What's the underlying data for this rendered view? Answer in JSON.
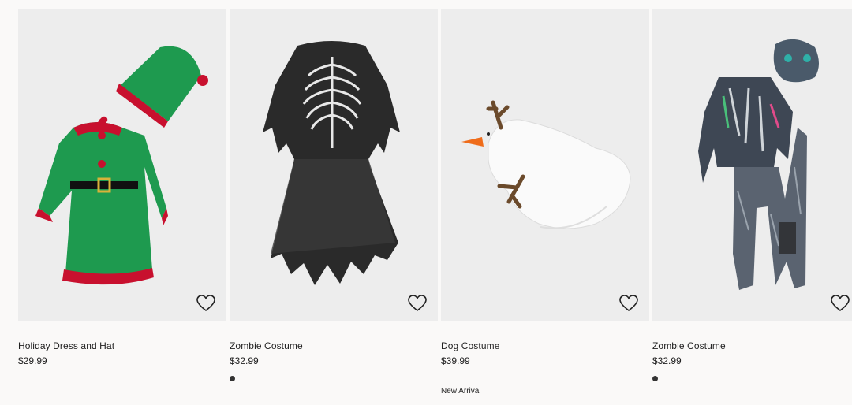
{
  "products": [
    {
      "name": "Holiday Dress and Hat",
      "price": "$29.99",
      "badge": "",
      "swatch": false,
      "icon": "heart-outline-icon"
    },
    {
      "name": "Zombie Costume",
      "price": "$32.99",
      "badge": "",
      "swatch": true,
      "icon": "heart-outline-icon"
    },
    {
      "name": "Dog Costume",
      "price": "$39.99",
      "badge": "New Arrival",
      "swatch": false,
      "icon": "heart-outline-icon"
    },
    {
      "name": "Zombie Costume",
      "price": "$32.99",
      "badge": "",
      "swatch": true,
      "icon": "heart-outline-icon"
    }
  ],
  "colors": {
    "background": "#faf9f8",
    "image_bg": "#ededed",
    "text": "#222222",
    "swatch": "#333333"
  }
}
